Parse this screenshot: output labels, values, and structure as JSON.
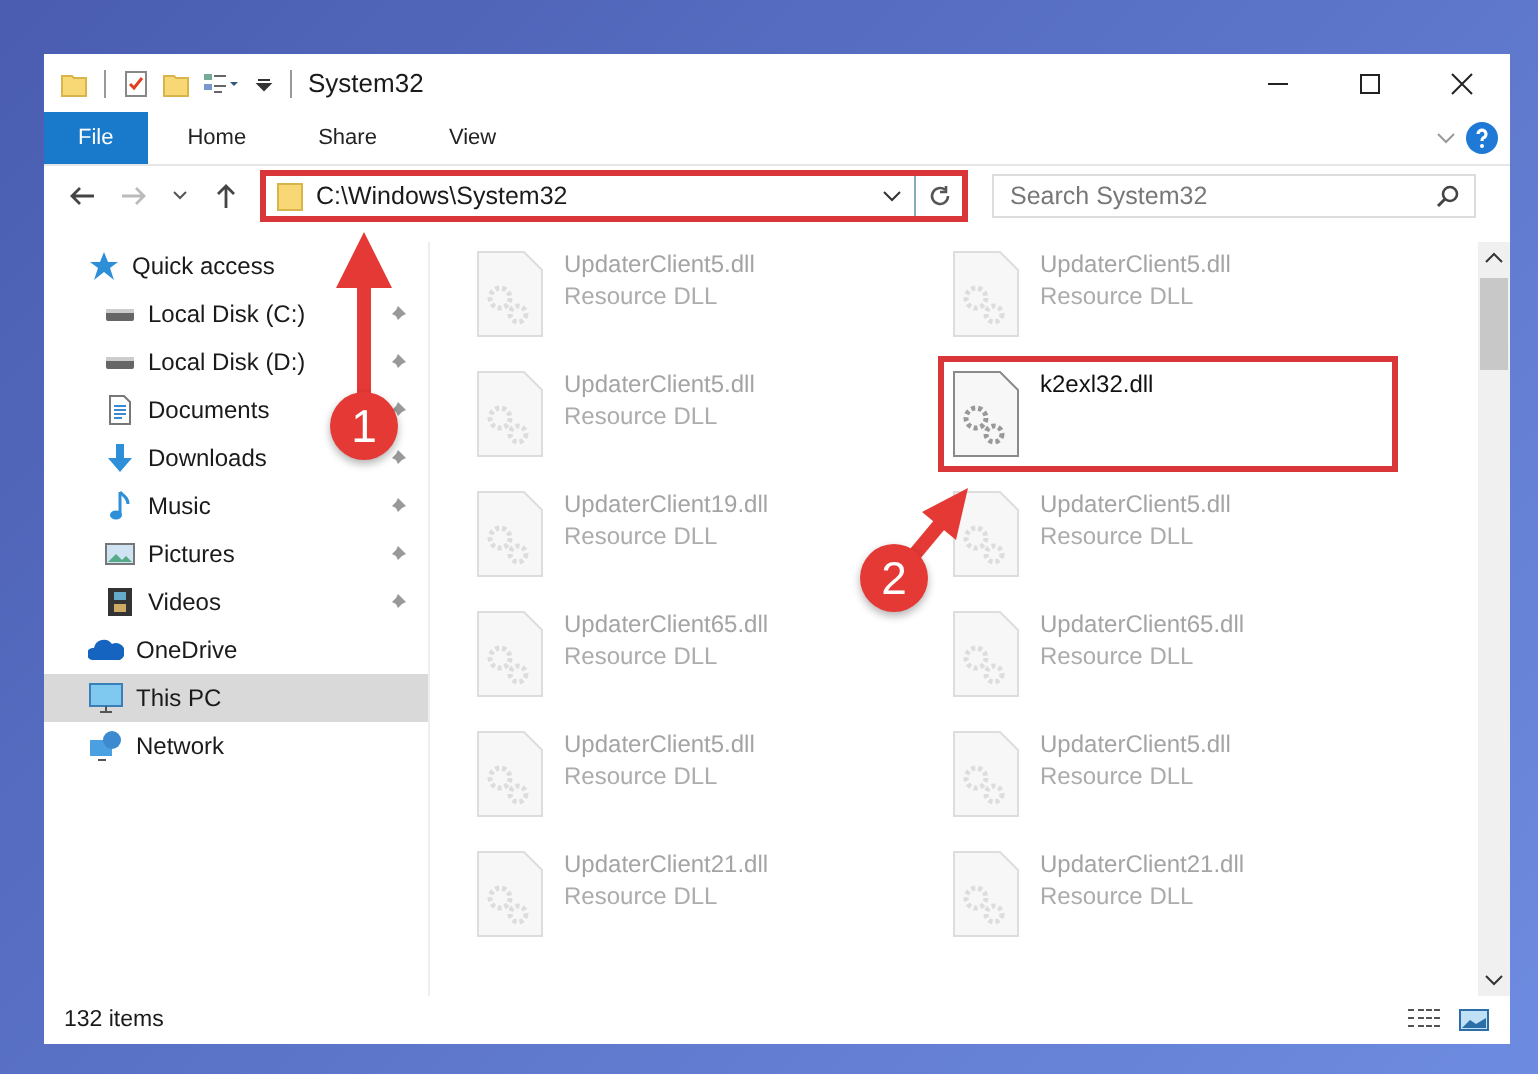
{
  "window": {
    "title": "System32"
  },
  "ribbon": {
    "tabs": [
      {
        "label": "File",
        "selected": true
      },
      {
        "label": "Home",
        "selected": false
      },
      {
        "label": "Share",
        "selected": false
      },
      {
        "label": "View",
        "selected": false
      }
    ]
  },
  "address_bar": {
    "path": "C:\\Windows\\System32"
  },
  "search": {
    "placeholder": "Search System32"
  },
  "sidebar": {
    "items": [
      {
        "label": "Quick access",
        "kind": "star",
        "selected": false,
        "children": [
          {
            "label": "Local Disk (C:)",
            "kind": "disk",
            "pinned": true
          },
          {
            "label": "Local Disk (D:)",
            "kind": "disk",
            "pinned": true
          },
          {
            "label": "Documents",
            "kind": "docs",
            "pinned": true
          },
          {
            "label": "Downloads",
            "kind": "download",
            "pinned": true
          },
          {
            "label": "Music",
            "kind": "music",
            "pinned": true
          },
          {
            "label": "Pictures",
            "kind": "pictures",
            "pinned": true
          },
          {
            "label": "Videos",
            "kind": "videos",
            "pinned": true
          }
        ]
      },
      {
        "label": "OneDrive",
        "kind": "cloud",
        "selected": false
      },
      {
        "label": "This PC",
        "kind": "pc",
        "selected": true
      },
      {
        "label": "Network",
        "kind": "network",
        "selected": false
      }
    ]
  },
  "files": [
    {
      "name": "UpdaterClient5.dll",
      "type": "Resource DLL",
      "highlighted": false
    },
    {
      "name": "UpdaterClient5.dll",
      "type": "Resource DLL",
      "highlighted": false
    },
    {
      "name": "UpdaterClient5.dll",
      "type": "Resource DLL",
      "highlighted": false
    },
    {
      "name": "k2exl32.dll",
      "highlighted": true
    },
    {
      "name": "UpdaterClient19.dll",
      "type": "Resource DLL",
      "highlighted": false
    },
    {
      "name": "UpdaterClient5.dll",
      "type": "Resource DLL",
      "highlighted": false
    },
    {
      "name": "UpdaterClient65.dll",
      "type": "Resource DLL",
      "highlighted": false
    },
    {
      "name": "UpdaterClient65.dll",
      "type": "Resource DLL",
      "highlighted": false
    },
    {
      "name": "UpdaterClient5.dll",
      "type": "Resource DLL",
      "highlighted": false
    },
    {
      "name": "UpdaterClient5.dll",
      "type": "Resource DLL",
      "highlighted": false
    },
    {
      "name": "UpdaterClient21.dll",
      "type": "Resource DLL",
      "highlighted": false
    },
    {
      "name": "UpdaterClient21.dll",
      "type": "Resource DLL",
      "highlighted": false
    }
  ],
  "status_bar": {
    "item_count": "132 items"
  },
  "annotations": [
    {
      "number": "1"
    },
    {
      "number": "2"
    }
  ]
}
